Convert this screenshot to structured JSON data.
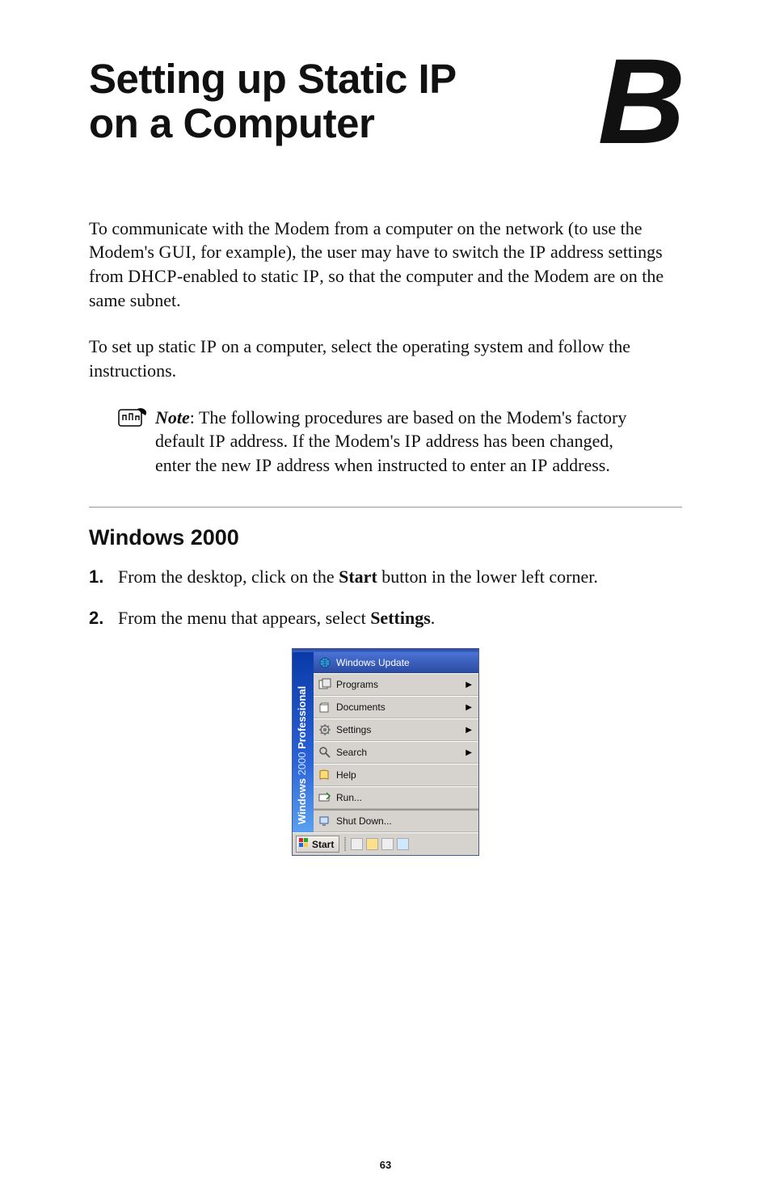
{
  "appendix_letter": "B",
  "title_line1": "Setting up Static IP",
  "title_line2": "on a Computer",
  "intro": {
    "p1_a": "To communicate with the Modem from a computer on the network (to use the Modem's ",
    "p1_b": ", for example), the user may have to switch the ",
    "p1_c": " address settings from ",
    "p1_d": "-enabled to static ",
    "p1_e": ", so that the computer and the Modem are on the same subnet.",
    "gui": "GUI",
    "ip": "IP",
    "dhcp": "DHCP",
    "p2_a": "To set up static ",
    "p2_b": " on a computer, select the operating system and follow the instructions."
  },
  "note": {
    "label": "Note",
    "t1": ": The following procedures are based on the Modem's factory default ",
    "t2": " address. If the Modem's ",
    "t3": " address has been changed, enter the new ",
    "t4": " address when instructed to enter an ",
    "t5": " address.",
    "ip": "IP"
  },
  "section_heading": "Windows 2000",
  "steps": [
    {
      "n": "1.",
      "pre": "From the desktop, click on the ",
      "bold": "Start",
      "post": " button in the lower left corner."
    },
    {
      "n": "2.",
      "pre": "From the menu that appears, select ",
      "bold": "Settings",
      "post": "."
    }
  ],
  "startmenu": {
    "brand": "Windows 2000 Professional",
    "windows_update": "Windows Update",
    "programs": "Programs",
    "documents": "Documents",
    "settings": "Settings",
    "search": "Search",
    "help": "Help",
    "run": "Run...",
    "shutdown": "Shut Down...",
    "start": "Start"
  },
  "page_number": "63"
}
